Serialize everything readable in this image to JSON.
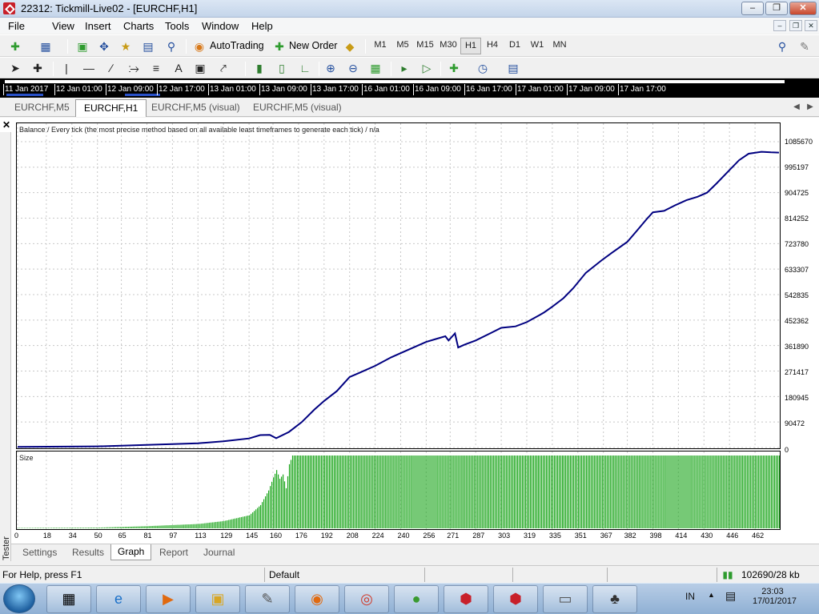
{
  "window": {
    "title": "22312: Tickmill-Live02 - [EURCHF,H1]"
  },
  "menu": [
    "File",
    "View",
    "Insert",
    "Charts",
    "Tools",
    "Window",
    "Help"
  ],
  "toolbar": {
    "autotrading_label": "AutoTrading",
    "new_order_label": "New Order",
    "timeframes": [
      "M1",
      "M5",
      "M15",
      "M30",
      "H1",
      "H4",
      "D1",
      "W1",
      "MN"
    ],
    "active_timeframe": "H1"
  },
  "timestrip": [
    "11 Jan 2017",
    "12 Jan 01:00",
    "12 Jan 09:00",
    "12 Jan 17:00",
    "13 Jan 01:00",
    "13 Jan 09:00",
    "13 Jan 17:00",
    "16 Jan 01:00",
    "16 Jan 09:00",
    "16 Jan 17:00",
    "17 Jan 01:00",
    "17 Jan 09:00",
    "17 Jan 17:00"
  ],
  "chart_tabs": [
    "EURCHF,M5",
    "EURCHF,H1",
    "EURCHF,M5 (visual)",
    "EURCHF,M5 (visual)"
  ],
  "active_chart_tab": "EURCHF,H1",
  "tester": {
    "side_label": "Tester",
    "tabs": [
      "Settings",
      "Results",
      "Graph",
      "Report",
      "Journal"
    ],
    "active_tab": "Graph"
  },
  "chart_data": [
    {
      "type": "line",
      "title": "Balance / Every tick (the most precise method based on all available least timeframes to generate each tick) / n/a",
      "y_ticks": [
        "1085670",
        "995197",
        "904725",
        "814252",
        "723780",
        "633307",
        "542835",
        "452362",
        "361890",
        "271417",
        "180945",
        "90472",
        "0"
      ],
      "ylim": [
        0,
        1085670
      ],
      "x_ticks": [
        "0",
        "18",
        "34",
        "50",
        "65",
        "81",
        "97",
        "113",
        "129",
        "145",
        "160",
        "176",
        "192",
        "208",
        "224",
        "240",
        "256",
        "271",
        "287",
        "303",
        "319",
        "335",
        "351",
        "367",
        "382",
        "398",
        "414",
        "430",
        "446",
        "462"
      ],
      "xlim": [
        0,
        477
      ],
      "series": [
        {
          "color": "#000080",
          "x": [
            0,
            50,
            81,
            113,
            129,
            145,
            152,
            158,
            162,
            170,
            178,
            186,
            192,
            200,
            208,
            214,
            224,
            234,
            244,
            256,
            262,
            268,
            270,
            274,
            276,
            280,
            287,
            296,
            303,
            312,
            319,
            327,
            330,
            335,
            342,
            348,
            356,
            366,
            372,
            382,
            388,
            394,
            398,
            405,
            412,
            419,
            426,
            432,
            438,
            446,
            452,
            458,
            466,
            472,
            477
          ],
          "y": [
            2000,
            4000,
            9000,
            15000,
            22000,
            32000,
            44000,
            45000,
            33000,
            55000,
            90000,
            135000,
            165000,
            200000,
            250000,
            265000,
            290000,
            320000,
            345000,
            375000,
            385000,
            395000,
            380000,
            405000,
            355000,
            365000,
            380000,
            405000,
            425000,
            430000,
            445000,
            470000,
            480000,
            500000,
            530000,
            565000,
            620000,
            665000,
            690000,
            730000,
            770000,
            810000,
            835000,
            840000,
            860000,
            878000,
            890000,
            905000,
            938000,
            985000,
            1020000,
            1043000,
            1050000,
            1048000,
            1047000
          ]
        }
      ]
    },
    {
      "type": "bar",
      "title": "Size",
      "ylim": [
        0,
        100
      ],
      "ramp": {
        "x": [
          0,
          50,
          81,
          113,
          129,
          145,
          152,
          157,
          160,
          162,
          164,
          166,
          168,
          170,
          172,
          175,
          477
        ],
        "y": [
          0.5,
          1,
          3,
          6,
          10,
          18,
          32,
          52,
          70,
          80,
          68,
          74,
          55,
          88,
          100,
          100,
          100
        ]
      },
      "color": "#1aa51a"
    }
  ],
  "statusbar": {
    "help": "For Help, press F1",
    "profile": "Default",
    "traffic": "102690/28 kb"
  },
  "taskbar": {
    "items": [
      "calculator",
      "internet-explorer",
      "media-player",
      "file-explorer",
      "notepad",
      "firefox",
      "chrome",
      "messenger",
      "metatrader",
      "metatrader",
      "writer",
      "education"
    ],
    "language": "IN",
    "time": "23:03",
    "date": "17/01/2017"
  }
}
